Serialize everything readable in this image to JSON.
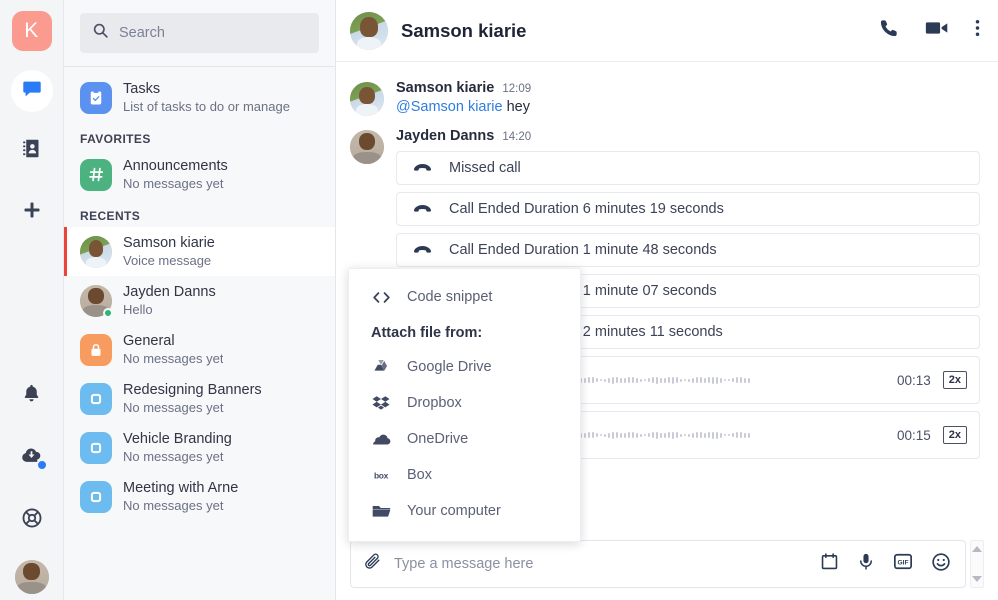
{
  "rail": {
    "logo_letter": "K",
    "items": [
      {
        "name": "chat",
        "icon": "chat-bubble-icon",
        "active": true
      },
      {
        "name": "contacts",
        "icon": "contacts-book-icon",
        "active": false
      },
      {
        "name": "add",
        "icon": "plus-icon",
        "active": false
      }
    ],
    "bottom_items": [
      {
        "name": "notifications",
        "icon": "bell-icon"
      },
      {
        "name": "downloads",
        "icon": "cloud-download-icon"
      },
      {
        "name": "help",
        "icon": "lifebuoy-icon"
      },
      {
        "name": "profile",
        "icon": "user-avatar"
      }
    ]
  },
  "search": {
    "placeholder": "Search",
    "value": "",
    "icon": "search-icon"
  },
  "sidebar": {
    "tasks": {
      "title": "Tasks",
      "subtitle": "List of tasks to do or manage",
      "icon": "clipboard-check-icon",
      "color": "#5b92ef"
    },
    "favorites_label": "FAVORITES",
    "favorites": [
      {
        "title": "Announcements",
        "subtitle": "No messages yet",
        "icon": "hash-icon",
        "color": "#4cb380",
        "kind": "square"
      }
    ],
    "recents_label": "RECENTS",
    "recents": [
      {
        "title": "Samson kiarie",
        "subtitle": "Voice message",
        "kind": "avatar",
        "avatar": "a",
        "selected": true,
        "presence": null
      },
      {
        "title": "Jayden Danns",
        "subtitle": "Hello",
        "kind": "avatar",
        "avatar": "b",
        "selected": false,
        "presence": "#2bb673"
      },
      {
        "title": "General",
        "subtitle": "No messages yet",
        "kind": "square",
        "icon": "lock-icon",
        "color": "#f89b5e",
        "selected": false
      },
      {
        "title": "Redesigning Banners",
        "subtitle": "No messages yet",
        "kind": "square",
        "icon": "square-rounded-icon",
        "color": "#6dbcf0",
        "selected": false
      },
      {
        "title": "Vehicle Branding",
        "subtitle": "No messages yet",
        "kind": "square",
        "icon": "square-rounded-icon",
        "color": "#6dbcf0",
        "selected": false
      },
      {
        "title": "Meeting with Arne",
        "subtitle": "No messages yet",
        "kind": "square",
        "icon": "square-rounded-icon",
        "color": "#6dbcf0",
        "selected": false
      }
    ]
  },
  "chat_header": {
    "title": "Samson kiarie",
    "actions": [
      {
        "name": "audio-call",
        "icon": "phone-icon"
      },
      {
        "name": "video-call",
        "icon": "video-camera-icon"
      },
      {
        "name": "more-options",
        "icon": "kebab-menu-icon"
      }
    ]
  },
  "messages": [
    {
      "author": "Samson kiarie",
      "time": "12:09",
      "avatar": "a",
      "items": [
        {
          "type": "text",
          "mention": "@Samson kiarie",
          "text": " hey"
        }
      ]
    },
    {
      "author": "Jayden Danns",
      "time": "14:20",
      "avatar": "b",
      "items": [
        {
          "type": "call",
          "label": "Missed call",
          "icon": "phone-hangup-icon"
        },
        {
          "type": "call",
          "label": "Call Ended Duration 6 minutes 19 seconds",
          "icon": "phone-hangup-icon"
        },
        {
          "type": "call",
          "label": "Call Ended Duration 1 minute 48 seconds",
          "icon": "phone-hangup-icon"
        },
        {
          "type": "call",
          "label": "Call Ended Duration 1 minute 07 seconds",
          "icon": "phone-hangup-icon"
        },
        {
          "type": "call",
          "label": "Call Ended Duration 2 minutes 11 seconds",
          "icon": "phone-hangup-icon"
        },
        {
          "type": "voice",
          "duration": "00:13",
          "speed": "2x",
          "icon": "play-icon"
        },
        {
          "type": "voice",
          "duration": "00:15",
          "speed": "2x",
          "icon": "play-icon"
        }
      ]
    }
  ],
  "context_menu": {
    "code_snippet": {
      "label": "Code snippet",
      "icon": "code-brackets-icon"
    },
    "heading": "Attach file from:",
    "sources": [
      {
        "label": "Google Drive",
        "icon": "google-drive-icon"
      },
      {
        "label": "Dropbox",
        "icon": "dropbox-icon"
      },
      {
        "label": "OneDrive",
        "icon": "onedrive-icon"
      },
      {
        "label": "Box",
        "icon": "box-icon"
      },
      {
        "label": "Your computer",
        "icon": "folder-icon"
      }
    ]
  },
  "composer": {
    "placeholder": "Type a message here",
    "value": "",
    "attach_icon": "paperclip-icon",
    "actions": [
      {
        "name": "schedule",
        "icon": "calendar-icon"
      },
      {
        "name": "voice-record",
        "icon": "microphone-icon"
      },
      {
        "name": "gif",
        "icon": "gif-icon"
      },
      {
        "name": "emoji",
        "icon": "smiley-icon"
      }
    ]
  },
  "colors": {
    "brand": "#fb9a8e",
    "accent_blue": "#2a7bf6",
    "selected_bar": "#e8443a",
    "presence_online": "#2bb673",
    "mention": "#2f7de1"
  }
}
